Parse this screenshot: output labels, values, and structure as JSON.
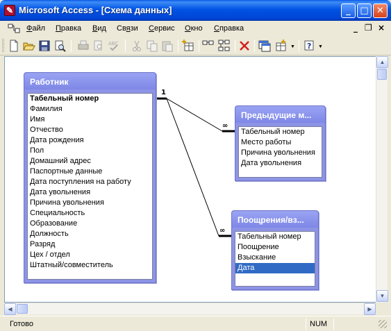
{
  "window": {
    "title": "Microsoft Access - [Схема данных]",
    "icon": "access-icon",
    "buttons": {
      "minimize": "_",
      "maximize": "□",
      "close": "✕"
    }
  },
  "menu": {
    "items": [
      "Файл",
      "Правка",
      "Вид",
      "Связи",
      "Сервис",
      "Окно",
      "Справка"
    ],
    "underlined": [
      "Ф",
      "П",
      "В",
      "я",
      "С",
      "О",
      "С"
    ],
    "mdi_buttons": {
      "minimize": "_",
      "restore": "❐",
      "close": "×"
    }
  },
  "toolbar": {
    "buttons": [
      "new-icon",
      "open-icon",
      "save-icon",
      "print-preview-icon",
      "print-icon",
      "preview-icon",
      "spelling-icon",
      "cut-icon",
      "copy-icon",
      "paste-icon",
      "show-table-icon",
      "show-direct-icon",
      "show-all-icon",
      "delete-icon",
      "database-window-icon",
      "new-object-icon",
      "help-icon"
    ]
  },
  "tables": [
    {
      "title": "Работник",
      "fields": [
        "Табельный номер",
        "Фамилия",
        "Имя",
        "Отчество",
        "Дата рождения",
        "Пол",
        "Домашний адрес",
        "Паспортные данные",
        "Дата поступления на работу",
        "Дата увольнения",
        "Причина увольнения",
        "Специальность",
        "Образование",
        "Должность",
        "Разряд",
        "Цех / отдел",
        "Штатный/совместитель"
      ],
      "primary_key": "Табельный номер"
    },
    {
      "title": "Предыдущие м...",
      "fields": [
        "Табельный номер",
        "Место работы",
        "Причина увольнения",
        "Дата увольнения"
      ]
    },
    {
      "title": "Поощрения/вз...",
      "fields": [
        "Табельный номер",
        "Поощрение",
        "Взыскание",
        "Дата"
      ],
      "selected_field": "Дата"
    }
  ],
  "relationships": [
    {
      "from": "Работник",
      "to": "Предыдущие м...",
      "one_label": "1",
      "many_label": "∞"
    },
    {
      "from": "Работник",
      "to": "Поощрения/вз...",
      "one_label": "1",
      "many_label": "∞"
    }
  ],
  "status": {
    "text": "Готово",
    "num": "NUM"
  },
  "colors": {
    "titlebar": "#0054e3",
    "table_header": "#8d94e6",
    "selection": "#316ac5"
  }
}
